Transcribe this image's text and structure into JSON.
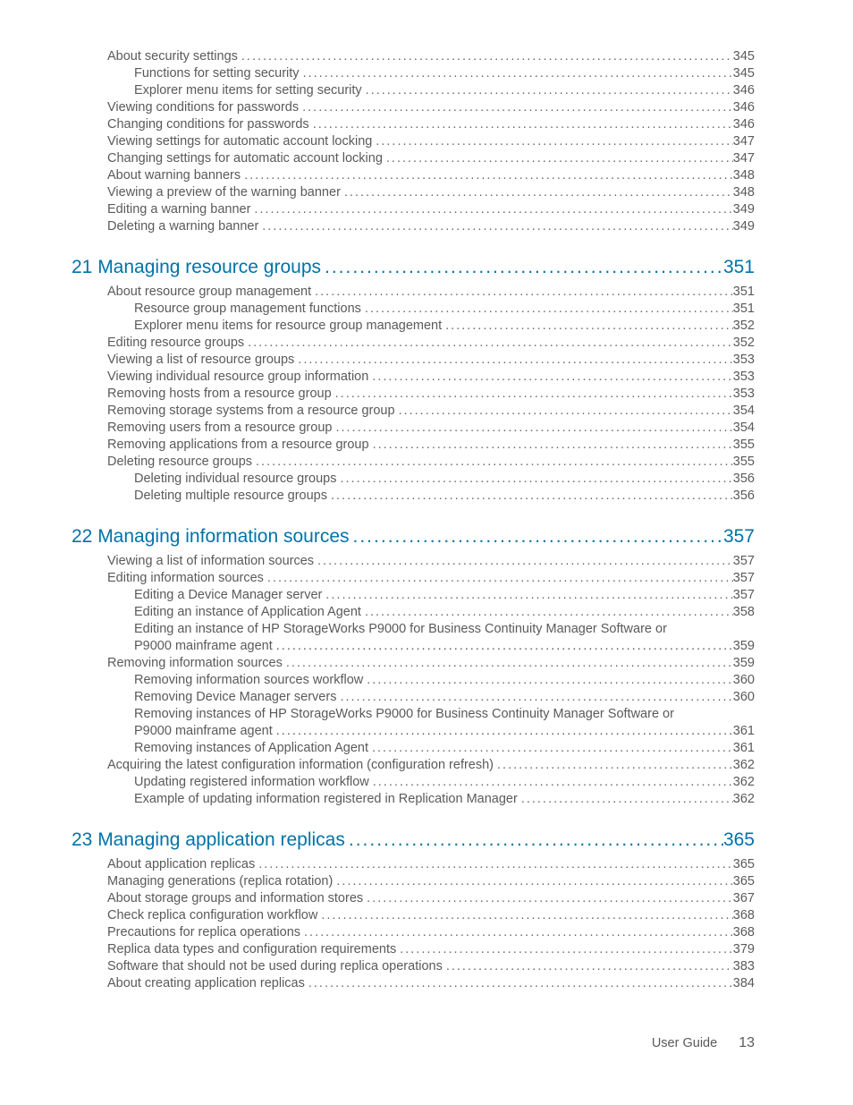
{
  "footer": {
    "label": "User Guide",
    "page": "13"
  },
  "pre_items": [
    {
      "indent": 1,
      "label": "About security settings",
      "page": "345"
    },
    {
      "indent": 2,
      "label": "Functions for setting security",
      "page": "345"
    },
    {
      "indent": 2,
      "label": "Explorer menu items for setting security",
      "page": "346"
    },
    {
      "indent": 1,
      "label": "Viewing conditions for passwords",
      "page": "346"
    },
    {
      "indent": 1,
      "label": "Changing conditions for passwords",
      "page": "346"
    },
    {
      "indent": 1,
      "label": "Viewing settings for automatic account locking",
      "page": "347"
    },
    {
      "indent": 1,
      "label": "Changing settings for automatic account locking",
      "page": "347"
    },
    {
      "indent": 1,
      "label": "About warning banners",
      "page": "348"
    },
    {
      "indent": 1,
      "label": "Viewing a preview of the warning banner",
      "page": "348"
    },
    {
      "indent": 1,
      "label": "Editing a warning banner",
      "page": "349"
    },
    {
      "indent": 1,
      "label": "Deleting a warning banner",
      "page": "349"
    }
  ],
  "chapters": [
    {
      "num": "21",
      "title": "Managing resource groups",
      "page": "351",
      "items": [
        {
          "indent": 1,
          "label": "About resource group management",
          "page": "351"
        },
        {
          "indent": 2,
          "label": "Resource group management functions",
          "page": "351"
        },
        {
          "indent": 2,
          "label": "Explorer menu items for resource group management",
          "page": "352"
        },
        {
          "indent": 1,
          "label": "Editing resource groups",
          "page": "352"
        },
        {
          "indent": 1,
          "label": "Viewing a list of resource groups",
          "page": "353"
        },
        {
          "indent": 1,
          "label": "Viewing individual resource group information",
          "page": "353"
        },
        {
          "indent": 1,
          "label": "Removing hosts from a resource group",
          "page": "353"
        },
        {
          "indent": 1,
          "label": "Removing storage systems from a resource group",
          "page": "354"
        },
        {
          "indent": 1,
          "label": "Removing users from a resource group",
          "page": "354"
        },
        {
          "indent": 1,
          "label": "Removing applications from a resource group",
          "page": "355"
        },
        {
          "indent": 1,
          "label": "Deleting resource groups",
          "page": "355"
        },
        {
          "indent": 2,
          "label": "Deleting individual resource groups",
          "page": "356"
        },
        {
          "indent": 2,
          "label": "Deleting multiple resource groups",
          "page": "356"
        }
      ]
    },
    {
      "num": "22",
      "title": "Managing information sources",
      "page": "357",
      "items": [
        {
          "indent": 1,
          "label": "Viewing a list of information sources",
          "page": "357"
        },
        {
          "indent": 1,
          "label": "Editing information sources",
          "page": "357"
        },
        {
          "indent": 2,
          "label": "Editing a Device Manager server",
          "page": "357"
        },
        {
          "indent": 2,
          "label": "Editing an instance of Application Agent",
          "page": "358"
        },
        {
          "indent": 2,
          "wrap": true,
          "line1": "Editing an instance of HP StorageWorks P9000 for Business Continuity Manager Software or",
          "line2": "P9000 mainframe agent",
          "page": "359"
        },
        {
          "indent": 1,
          "label": "Removing information sources",
          "page": "359"
        },
        {
          "indent": 2,
          "label": "Removing information sources workflow",
          "page": "360"
        },
        {
          "indent": 2,
          "label": "Removing Device Manager servers",
          "page": "360"
        },
        {
          "indent": 2,
          "wrap": true,
          "line1": "Removing instances of HP StorageWorks P9000 for Business Continuity Manager Software or",
          "line2": "P9000 mainframe agent",
          "page": "361"
        },
        {
          "indent": 2,
          "label": "Removing instances of Application Agent",
          "page": "361"
        },
        {
          "indent": 1,
          "label": "Acquiring the latest configuration information (configuration refresh)",
          "page": "362"
        },
        {
          "indent": 2,
          "label": "Updating registered information workflow",
          "page": "362"
        },
        {
          "indent": 2,
          "label": "Example of updating information registered in Replication Manager",
          "page": "362"
        }
      ]
    },
    {
      "num": "23",
      "title": "Managing application replicas",
      "page": "365",
      "items": [
        {
          "indent": 1,
          "label": "About application replicas",
          "page": "365"
        },
        {
          "indent": 1,
          "label": "Managing generations (replica rotation)",
          "page": "365"
        },
        {
          "indent": 1,
          "label": "About storage groups and information stores",
          "page": "367"
        },
        {
          "indent": 1,
          "label": "Check replica configuration workflow",
          "page": "368"
        },
        {
          "indent": 1,
          "label": "Precautions for replica operations",
          "page": "368"
        },
        {
          "indent": 1,
          "label": "Replica data types and configuration requirements",
          "page": "379"
        },
        {
          "indent": 1,
          "label": "Software that should not be used during replica operations",
          "page": "383"
        },
        {
          "indent": 1,
          "label": "About creating application replicas",
          "page": "384"
        }
      ]
    }
  ]
}
